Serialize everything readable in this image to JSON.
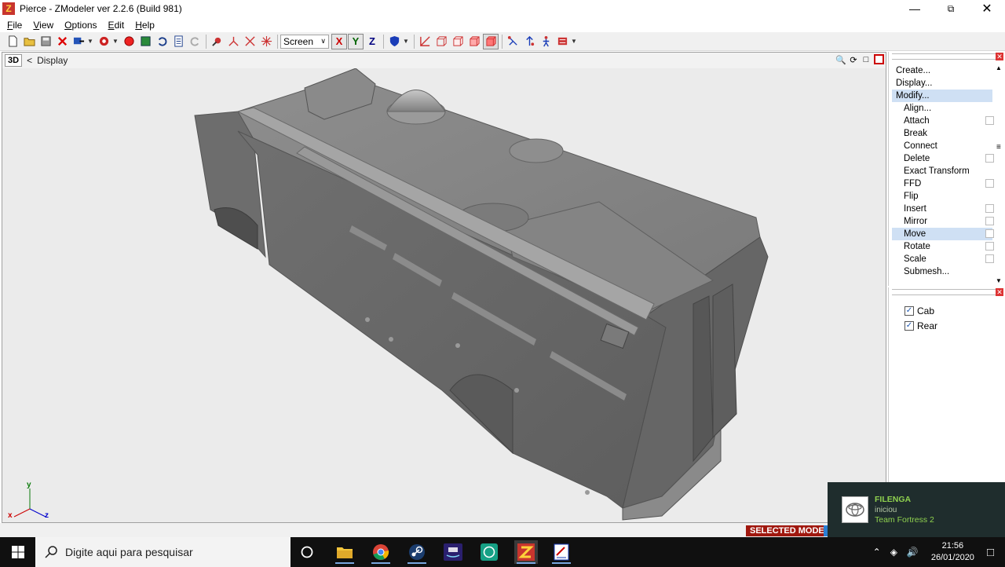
{
  "window": {
    "title": "Pierce - ZModeler ver 2.2.6 (Build 981)",
    "app_icon_letter": "Z"
  },
  "menu": [
    {
      "accel": "F",
      "rest": "ile"
    },
    {
      "accel": "V",
      "rest": "iew"
    },
    {
      "accel": "O",
      "rest": "ptions"
    },
    {
      "accel": "E",
      "rest": "dit"
    },
    {
      "accel": "H",
      "rest": "elp"
    }
  ],
  "toolbar": {
    "coord_mode": "Screen",
    "axis_x": "X",
    "axis_y": "Y",
    "axis_z": "Z"
  },
  "viewport": {
    "mode_label": "3D",
    "title": "Display",
    "nav_prefix": "<",
    "axis_y": "y",
    "axis_x": "x",
    "axis_z": "z"
  },
  "commands": {
    "items": [
      {
        "label": "Create...",
        "sub": false,
        "check": false,
        "selected": false
      },
      {
        "label": "Display...",
        "sub": false,
        "check": false,
        "selected": false
      },
      {
        "label": "Modify...",
        "sub": false,
        "check": false,
        "selected": true
      },
      {
        "label": "Align...",
        "sub": true,
        "check": false,
        "selected": false
      },
      {
        "label": "Attach",
        "sub": true,
        "check": true,
        "selected": false
      },
      {
        "label": "Break",
        "sub": true,
        "check": false,
        "selected": false
      },
      {
        "label": "Connect",
        "sub": true,
        "check": false,
        "selected": false
      },
      {
        "label": "Delete",
        "sub": true,
        "check": true,
        "selected": false
      },
      {
        "label": "Exact Transform",
        "sub": true,
        "check": false,
        "selected": false
      },
      {
        "label": "FFD",
        "sub": true,
        "check": true,
        "selected": false
      },
      {
        "label": "Flip",
        "sub": true,
        "check": false,
        "selected": false
      },
      {
        "label": "Insert",
        "sub": true,
        "check": true,
        "selected": false
      },
      {
        "label": "Mirror",
        "sub": true,
        "check": true,
        "selected": false
      },
      {
        "label": "Move",
        "sub": true,
        "check": true,
        "selected": true
      },
      {
        "label": "Rotate",
        "sub": true,
        "check": true,
        "selected": false
      },
      {
        "label": "Scale",
        "sub": true,
        "check": true,
        "selected": false
      },
      {
        "label": "Submesh...",
        "sub": true,
        "check": false,
        "selected": false
      }
    ]
  },
  "objects": [
    {
      "label": "Cab",
      "checked": true
    },
    {
      "label": "Rear",
      "checked": true
    }
  ],
  "status": {
    "mode": "SELECTED MODE"
  },
  "toast": {
    "name": "FILENGA",
    "line2": "iniciou",
    "line3": "Team Fortress 2"
  },
  "taskbar": {
    "search_placeholder": "Digite aqui para pesquisar",
    "time": "21:56",
    "date": "26/01/2020"
  }
}
